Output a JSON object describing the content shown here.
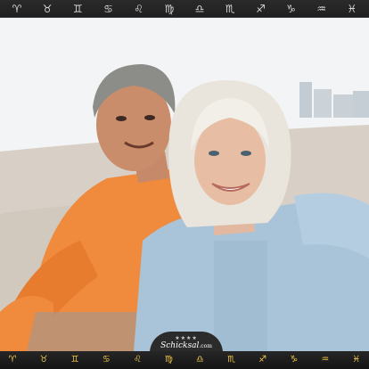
{
  "top_bar": {
    "signs": [
      {
        "glyph": "♈",
        "name": "aries"
      },
      {
        "glyph": "♉",
        "name": "taurus"
      },
      {
        "glyph": "♊",
        "name": "gemini"
      },
      {
        "glyph": "♋",
        "name": "cancer"
      },
      {
        "glyph": "♌",
        "name": "leo"
      },
      {
        "glyph": "♍",
        "name": "virgo"
      },
      {
        "glyph": "♎",
        "name": "libra"
      },
      {
        "glyph": "♏",
        "name": "scorpio"
      },
      {
        "glyph": "♐",
        "name": "sagittarius"
      },
      {
        "glyph": "♑",
        "name": "capricorn"
      },
      {
        "glyph": "♒",
        "name": "aquarius"
      },
      {
        "glyph": "♓",
        "name": "pisces"
      }
    ]
  },
  "photo": {
    "subject": "selfie-couple-on-beach"
  },
  "logo": {
    "stars": "★★★★",
    "brand": "Schicksal",
    "suffix": ".com"
  },
  "bottom_bar": {
    "badges": [
      {
        "glyph": "♈",
        "name": "aries-badge-icon"
      },
      {
        "glyph": "♉",
        "name": "taurus-badge-icon"
      },
      {
        "glyph": "♊",
        "name": "gemini-badge-icon"
      },
      {
        "glyph": "♋",
        "name": "cancer-badge-icon"
      },
      {
        "glyph": "♌",
        "name": "leo-badge-icon"
      },
      {
        "glyph": "♍",
        "name": "virgo-badge-icon"
      },
      {
        "glyph": "♎",
        "name": "libra-badge-icon"
      },
      {
        "glyph": "♏",
        "name": "scorpio-badge-icon"
      },
      {
        "glyph": "♐",
        "name": "sagittarius-badge-icon"
      },
      {
        "glyph": "♑",
        "name": "capricorn-badge-icon"
      },
      {
        "glyph": "♒",
        "name": "aquarius-badge-icon"
      },
      {
        "glyph": "♓",
        "name": "pisces-badge-icon"
      }
    ]
  },
  "colors": {
    "bar": "#222222",
    "badge_gold": "#f3c94a",
    "shirt_orange": "#f08a3c",
    "blouse_blue": "#a9c4d8"
  }
}
